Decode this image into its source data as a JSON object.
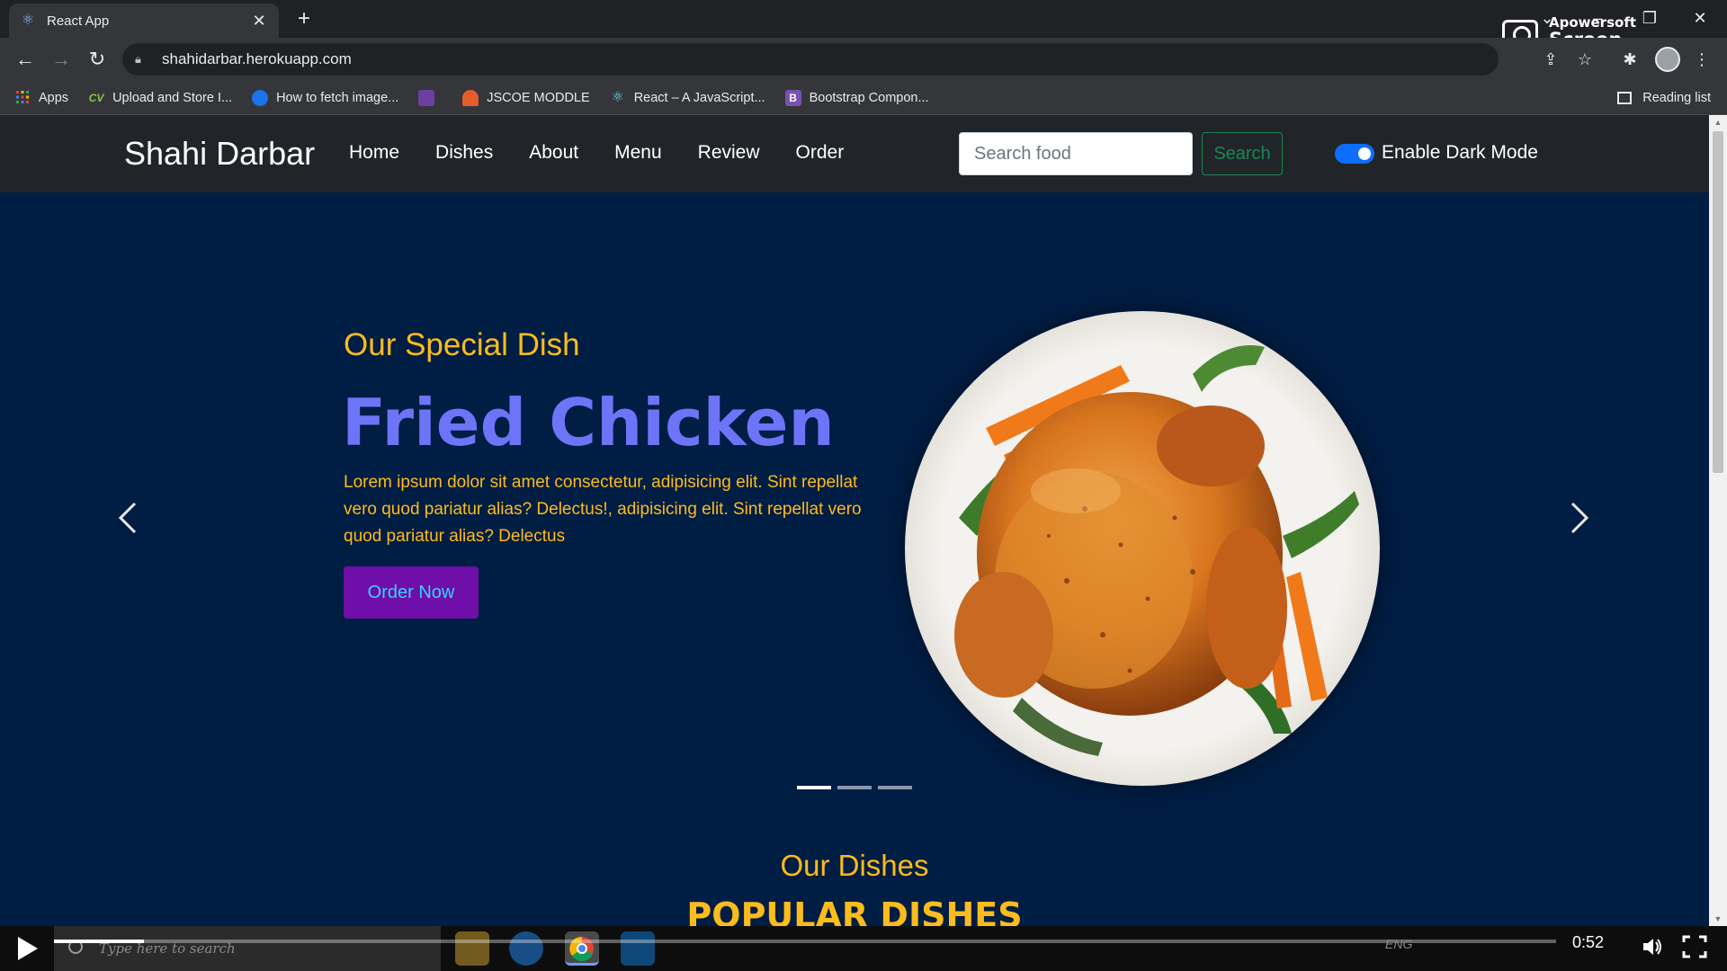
{
  "browser": {
    "tab": {
      "title": "React App",
      "favicon": "react-logo-icon"
    },
    "url": "shahidarbar.herokuapp.com",
    "bookmarks": [
      {
        "label": "Apps",
        "icon": "apps-grid-icon",
        "color": "#ea4335"
      },
      {
        "label": "Upload and Store I...",
        "icon": "cv-icon",
        "color": "#34a853"
      },
      {
        "label": "How to fetch image...",
        "icon": "blue-circle-icon",
        "color": "#1a73e8"
      },
      {
        "label": "",
        "icon": "purple-bookmark-icon",
        "color": "#6c3fa0"
      },
      {
        "label": "JSCOE MODDLE",
        "icon": "moodle-icon",
        "color": "#e65c2a"
      },
      {
        "label": "React – A JavaScript...",
        "icon": "react-logo-icon",
        "color": "#61dafb"
      },
      {
        "label": "Bootstrap Compon...",
        "icon": "bootstrap-icon",
        "color": "#7952b3"
      }
    ],
    "bookmark_glyphs": {
      "cv": "CV",
      "bootstrap": "B"
    },
    "reading_list": "Reading list"
  },
  "recorder": {
    "brand": "Apowersoft",
    "product": "Screen Recorder"
  },
  "site": {
    "brand": "Shahi Darbar",
    "nav": [
      "Home",
      "Dishes",
      "About",
      "Menu",
      "Review",
      "Order"
    ],
    "search_placeholder": "Search food",
    "search_button": "Search",
    "dark_mode_label": "Enable Dark Mode",
    "dark_mode_enabled": true
  },
  "hero": {
    "subtitle": "Our Special Dish",
    "title": "Fried Chicken",
    "text": "Lorem ipsum dolor sit amet consectetur, adipisicing elit. Sint repellat vero quod pariatur alias? Delectus!, adipisicing elit. Sint repellat vero quod pariatur alias? Delectus",
    "button": "Order Now",
    "image": "roast-chicken-plate-image",
    "slides_total": 3,
    "active_slide": 1
  },
  "section": {
    "subtitle": "Our Dishes",
    "title": "POPULAR DISHES"
  },
  "player": {
    "time": "0:52",
    "progress_fraction": 0.06,
    "taskbar_search_placeholder": "Type here to search",
    "tray_text": "ENG"
  },
  "colors": {
    "page_bg": "#001d44",
    "navbar_bg": "#212529",
    "accent_yellow": "#fcbc1c",
    "title_purple": "#6d74f7",
    "button_purple": "#6f0ea8",
    "button_text_cyan": "#35d4ff"
  }
}
